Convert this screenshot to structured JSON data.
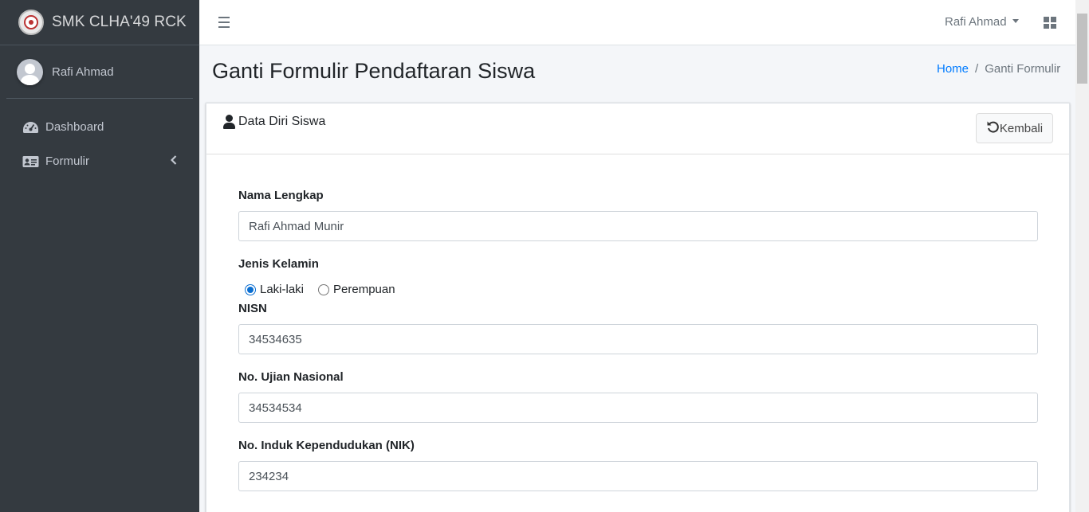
{
  "brand": {
    "name": "SMK CLHA'49 RCK"
  },
  "sidebar": {
    "user_name": "Rafi Ahmad",
    "items": [
      {
        "label": "Dashboard",
        "icon": "tachometer-icon"
      },
      {
        "label": "Formulir",
        "icon": "id-card-icon"
      }
    ]
  },
  "topbar": {
    "user_name": "Rafi Ahmad"
  },
  "page": {
    "title": "Ganti Formulir Pendaftaran Siswa",
    "breadcrumb": {
      "home": "Home",
      "separator": "/",
      "current": "Ganti Formulir"
    }
  },
  "card": {
    "title": "Data Diri Siswa",
    "back_label": "Kembali"
  },
  "form": {
    "nama_label": "Nama Lengkap",
    "nama_value": "Rafi Ahmad Munir",
    "gender_label": "Jenis Kelamin",
    "gender_options": [
      "Laki-laki",
      "Perempuan"
    ],
    "gender_selected": "Laki-laki",
    "nisn_label": "NISN",
    "nisn_value": "34534635",
    "un_label": "No. Ujian Nasional",
    "un_value": "34534534",
    "nik_label": "No. Induk Kependudukan (NIK)",
    "nik_value": "234234"
  },
  "colors": {
    "sidebar_bg": "#343a40",
    "link": "#007bff",
    "radio_accent": "#0a6ed1"
  }
}
